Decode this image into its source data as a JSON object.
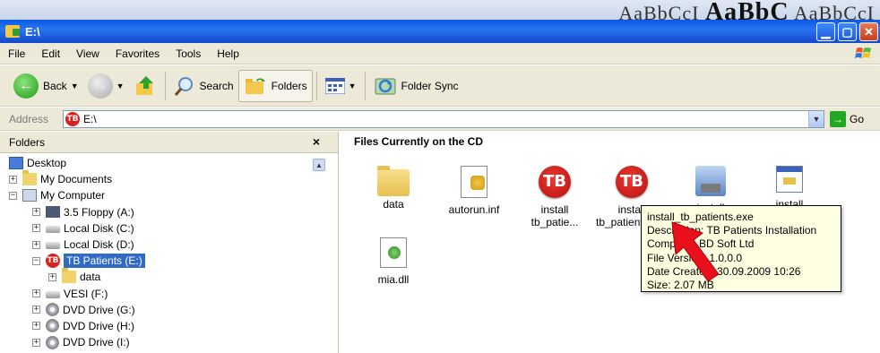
{
  "titlebar": {
    "title": "E:\\"
  },
  "background_strip": {
    "text1": "AaBbCcI",
    "text2": "AaBbC",
    "text3": "AaBbCcI"
  },
  "menu": {
    "items": [
      "File",
      "Edit",
      "View",
      "Favorites",
      "Tools",
      "Help"
    ]
  },
  "toolbar": {
    "back": "Back",
    "search": "Search",
    "folders": "Folders",
    "folder_sync": "Folder Sync"
  },
  "address": {
    "label": "Address",
    "value": "E:\\",
    "go": "Go",
    "badge": "TB"
  },
  "folders_pane": {
    "title": "Folders",
    "close": "×",
    "tree": [
      {
        "label": "Desktop",
        "icon": "desktop-icon",
        "indent": 0,
        "expander": ""
      },
      {
        "label": "My Documents",
        "icon": "my-documents-icon",
        "indent": 1,
        "expander": "+"
      },
      {
        "label": "My Computer",
        "icon": "my-computer-icon",
        "indent": 1,
        "expander": "−"
      },
      {
        "label": "3.5 Floppy (A:)",
        "icon": "floppy-icon",
        "indent": 2,
        "expander": "+"
      },
      {
        "label": "Local Disk (C:)",
        "icon": "hard-disk-icon",
        "indent": 2,
        "expander": "+"
      },
      {
        "label": "Local Disk (D:)",
        "icon": "hard-disk-icon",
        "indent": 2,
        "expander": "+"
      },
      {
        "label": "TB Patients (E:)",
        "icon": "tb-badge-icon",
        "indent": 2,
        "expander": "−",
        "selected": true
      },
      {
        "label": "data",
        "icon": "folder-icon",
        "indent": 3,
        "expander": "+"
      },
      {
        "label": "VESI (F:)",
        "icon": "hard-disk-icon",
        "indent": 2,
        "expander": "+"
      },
      {
        "label": "DVD Drive (G:)",
        "icon": "dvd-icon",
        "indent": 2,
        "expander": "+"
      },
      {
        "label": "DVD Drive (H:)",
        "icon": "dvd-icon",
        "indent": 2,
        "expander": "+"
      },
      {
        "label": "DVD Drive (I:)",
        "icon": "dvd-icon",
        "indent": 2,
        "expander": "+"
      }
    ]
  },
  "files_pane": {
    "title": "Files Currently on the CD",
    "files": [
      {
        "name1": "data",
        "name2": "",
        "icon": "folder"
      },
      {
        "name1": "autorun.inf",
        "name2": "",
        "icon": "doc"
      },
      {
        "name1": "install",
        "name2": "tb_patie...",
        "icon": "tb"
      },
      {
        "name1": "install",
        "name2": "tb_patients.exe",
        "icon": "tb"
      },
      {
        "name1": "install",
        "name2": "",
        "icon": "setup"
      },
      {
        "name1": "install",
        "name2": "",
        "icon": "win"
      },
      {
        "name1": "mia.dll",
        "name2": "",
        "icon": "dll"
      }
    ],
    "tb_badge": "TB"
  },
  "tooltip": {
    "line1": "install_tb_patients.exe",
    "line2": "Description: TB Patients Installation",
    "line3": "Company: BD Soft Ltd",
    "line4": "File Version: 1.0.0.0",
    "line5": "Date Created: 30.09.2009 10:26",
    "line6": "Size: 2.07 MB"
  },
  "colors": {
    "titlebar": "#0a58e6",
    "selection": "#316ac5",
    "tooltip_bg": "#ffffe1",
    "arrow": "#e8101a"
  }
}
